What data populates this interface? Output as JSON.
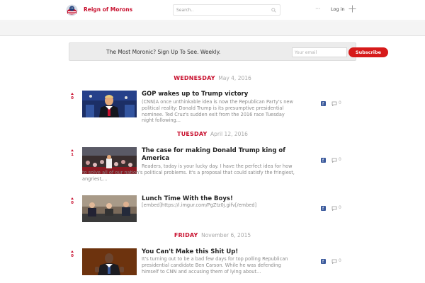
{
  "header": {
    "site_name": "Reign of Morons",
    "search_placeholder": "Search..",
    "more_label": "···",
    "login_label": "Log in"
  },
  "newsletter": {
    "text": "The Most Moronic? Sign Up To See. Weekly.",
    "email_placeholder": "Your email",
    "subscribe_label": "Subscribe"
  },
  "days": [
    {
      "name": "WEDNESDAY",
      "date": "May 4, 2016"
    },
    {
      "name": "TUESDAY",
      "date": "April 12, 2016"
    },
    {
      "name": "FRIDAY",
      "date": "November 6, 2015"
    }
  ],
  "posts": [
    {
      "votes": "0",
      "title": "GOP wakes up to Trump victory",
      "excerpt": "(CNN)A once unthinkable idea is now the Republican Party's new political reality: Donald Trump is its presumptive presidential nominee. Ted Cruz's sudden exit from the 2016 race Tuesday night following...",
      "comments": "0"
    },
    {
      "votes": "1",
      "title": "The case for making Donald Trump king of America",
      "excerpt": "Readers, today is your lucky day. I have the perfect idea for how to solve all of our nation's political problems. It's a proposal that could satisfy the fringiest, angriest,...",
      "comments": "0"
    },
    {
      "votes": "0",
      "title": "Lunch Time With the Boys!",
      "excerpt": "[embed]https://i.imgur.com/PgZtz0j.gifv[/embed]",
      "comments": "0"
    },
    {
      "votes": "0",
      "title": "You Can't Make this Shit Up!",
      "excerpt": "It's turning out to be a bad few days for top polling Republican presidential candidate Ben Carson. While he was defending himself to CNN and accusing them of lying about...",
      "comments": "0"
    }
  ]
}
